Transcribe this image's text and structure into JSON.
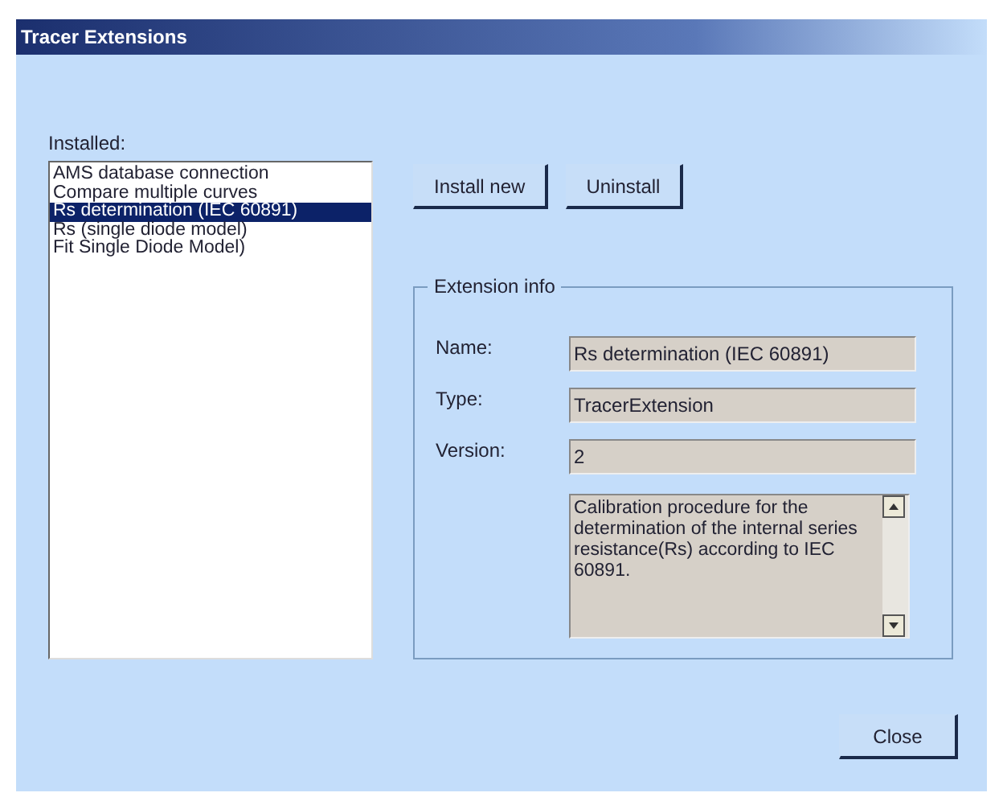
{
  "window": {
    "title": "Tracer Extensions"
  },
  "installed": {
    "label": "Installed:",
    "items": [
      {
        "text": "AMS database connection",
        "selected": false
      },
      {
        "text": "Compare multiple curves",
        "selected": false
      },
      {
        "text": "Rs determination (IEC 60891)",
        "selected": true
      },
      {
        "text": "Rs (single diode model)",
        "selected": false
      },
      {
        "text": "Fit Single Diode Model)",
        "selected": false
      }
    ]
  },
  "buttons": [
    "Install new",
    "Uninstall"
  ],
  "extension_info": {
    "title": "Extension info",
    "fields": [
      {
        "label": "Name:",
        "value": "Rs determination (IEC 60891)"
      },
      {
        "label": "Type:",
        "value": "TracerExtension"
      },
      {
        "label": "Version:",
        "value": "2"
      }
    ],
    "description": "Calibration procedure for the determination of the internal series resistance(Rs) according to IEC 60891."
  },
  "close_button": "Close"
}
